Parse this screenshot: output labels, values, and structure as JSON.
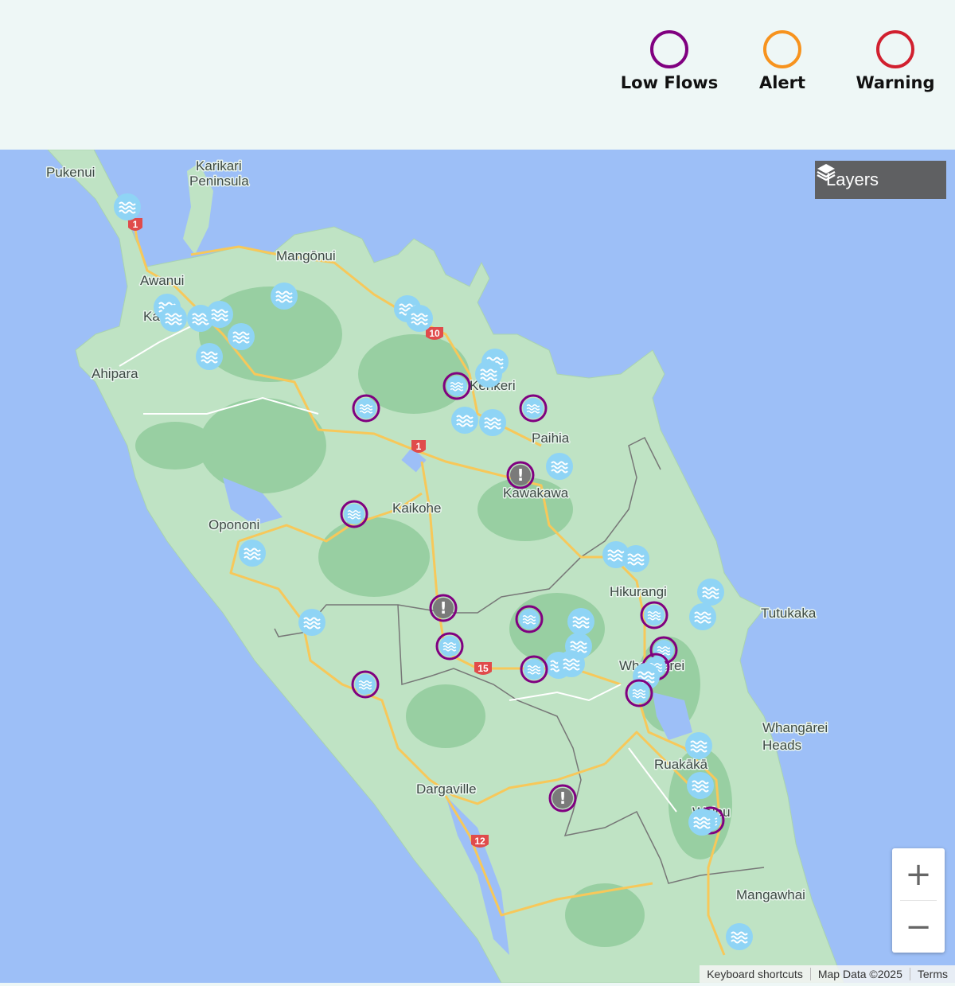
{
  "legend": {
    "items": [
      {
        "label": "Low Flows",
        "color": "#800080"
      },
      {
        "label": "Alert",
        "color": "#f7931e"
      },
      {
        "label": "Warning",
        "color": "#d1202f"
      }
    ]
  },
  "map": {
    "layers_label": "Layers",
    "zoom_in": "+",
    "zoom_out": "−",
    "attribution": {
      "shortcuts": "Keyboard shortcuts",
      "data": "Map Data ©2025",
      "terms": "Terms"
    },
    "places": [
      "Pukenui",
      "Karikari",
      "Peninsula",
      "Mangōnui",
      "Awanui",
      "Ka",
      "Ahipara",
      "Kerikeri",
      "Paihia",
      "Kawakawa",
      "Kaikohe",
      "Opononi",
      "Hikurangi",
      "Tutukaka",
      "Whangārei",
      "Whangārei",
      "Heads",
      "Ruakākā",
      "Waipu",
      "Dargaville",
      "Mangawhai"
    ],
    "route_shields": [
      "1",
      "10",
      "1",
      "15",
      "12"
    ],
    "colors": {
      "sea": "#9dbff7",
      "land": "#bfe3c4",
      "forest": "#98cfa2",
      "road": "#f7c85a",
      "station": "#8fd4f5",
      "low_flow_ring": "#800080"
    },
    "icons": [
      "water-station-icon",
      "low-flow-marker-icon",
      "warning-exclamation-icon",
      "layers-icon"
    ]
  }
}
